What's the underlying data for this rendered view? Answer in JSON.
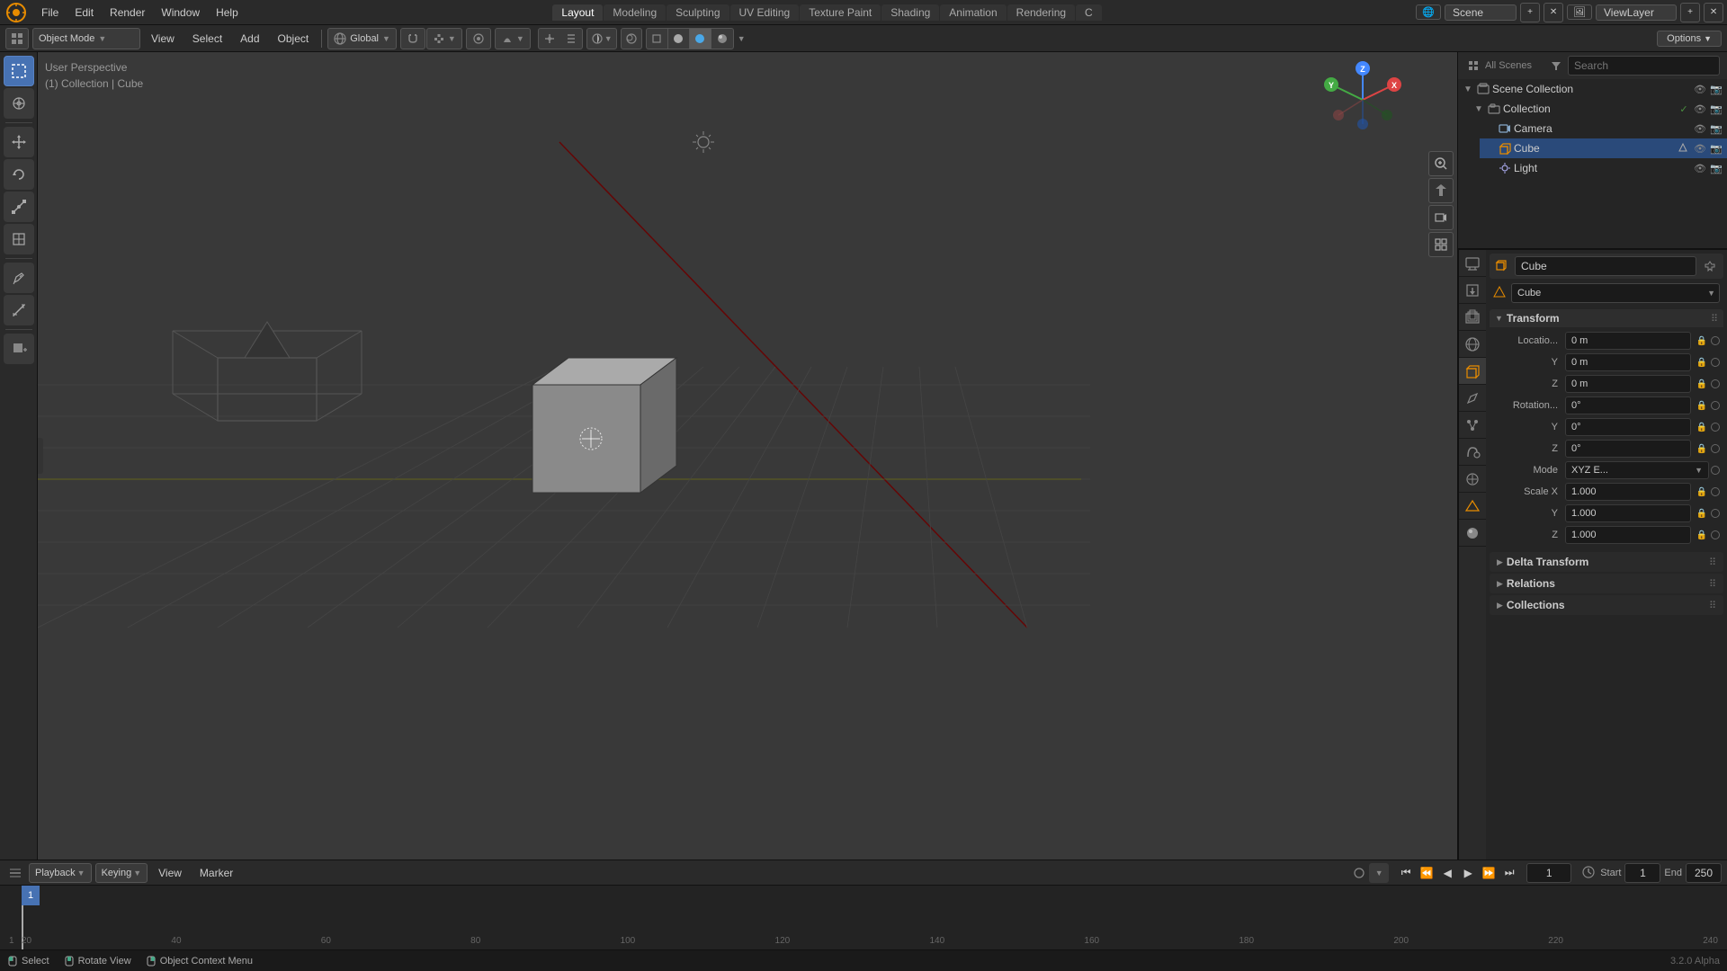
{
  "app": {
    "title": "Blender",
    "version": "3.2.0 Alpha"
  },
  "topMenu": {
    "items": [
      "File",
      "Edit",
      "Render",
      "Window",
      "Help"
    ],
    "workspaceTabs": [
      "Layout",
      "Modeling",
      "Sculpting",
      "UV Editing",
      "Texture Paint",
      "Shading",
      "Animation",
      "Rendering",
      "C"
    ],
    "activeTab": "Layout",
    "scene": "Scene",
    "viewLayer": "ViewLayer"
  },
  "secondToolbar": {
    "mode": "Object Mode",
    "view": "View",
    "select": "Select",
    "add": "Add",
    "object": "Object",
    "transform": "Global",
    "options": "Options"
  },
  "viewport": {
    "perspectiveLabel": "User Perspective",
    "selectionInfo": "(1) Collection | Cube"
  },
  "outliner": {
    "sceneCollection": "Scene Collection",
    "collection": "Collection",
    "camera": "Camera",
    "cube": "Cube",
    "light": "Light"
  },
  "properties": {
    "selectedObject": "Cube",
    "dataName": "Cube",
    "transform": {
      "title": "Transform",
      "locationX": "0 m",
      "locationY": "0 m",
      "locationZ": "0 m",
      "rotationX": "0°",
      "rotationY": "0°",
      "rotationZ": "0°",
      "mode": "XYZ E...",
      "scaleX": "1.000",
      "scaleY": "1.000",
      "scaleZ": "1.000"
    },
    "deltaTransform": "Delta Transform",
    "relations": "Relations",
    "collections": "Collections"
  },
  "timeline": {
    "playback": "Playback",
    "keying": "Keying",
    "view": "View",
    "marker": "Marker",
    "currentFrame": "1",
    "start": "1",
    "end": "250",
    "startLabel": "Start",
    "endLabel": "End",
    "marks": [
      "1",
      "20",
      "40",
      "60",
      "80",
      "100",
      "120",
      "140",
      "160",
      "180",
      "200",
      "220",
      "240"
    ]
  },
  "statusBar": {
    "select": "Select",
    "rotateView": "Rotate View",
    "contextMenu": "Object Context Menu",
    "selectIcon": "●",
    "rotateIcon": "◎",
    "contextIcon": "⊟"
  },
  "icons": {
    "logo": "🔷",
    "cursor": "⊕",
    "move": "✛",
    "rotate": "↺",
    "scale": "⇔",
    "transform": "⊞",
    "annotate": "✏",
    "measure": "📐",
    "addCube": "⬛",
    "zoomPlus": "⊕",
    "hand": "✋",
    "camera": "🎥",
    "grid": "⊞",
    "chevronDown": "▼",
    "chevronRight": "▶",
    "eye": "👁",
    "camera2": "📷",
    "lock": "🔒",
    "search": "🔍"
  }
}
